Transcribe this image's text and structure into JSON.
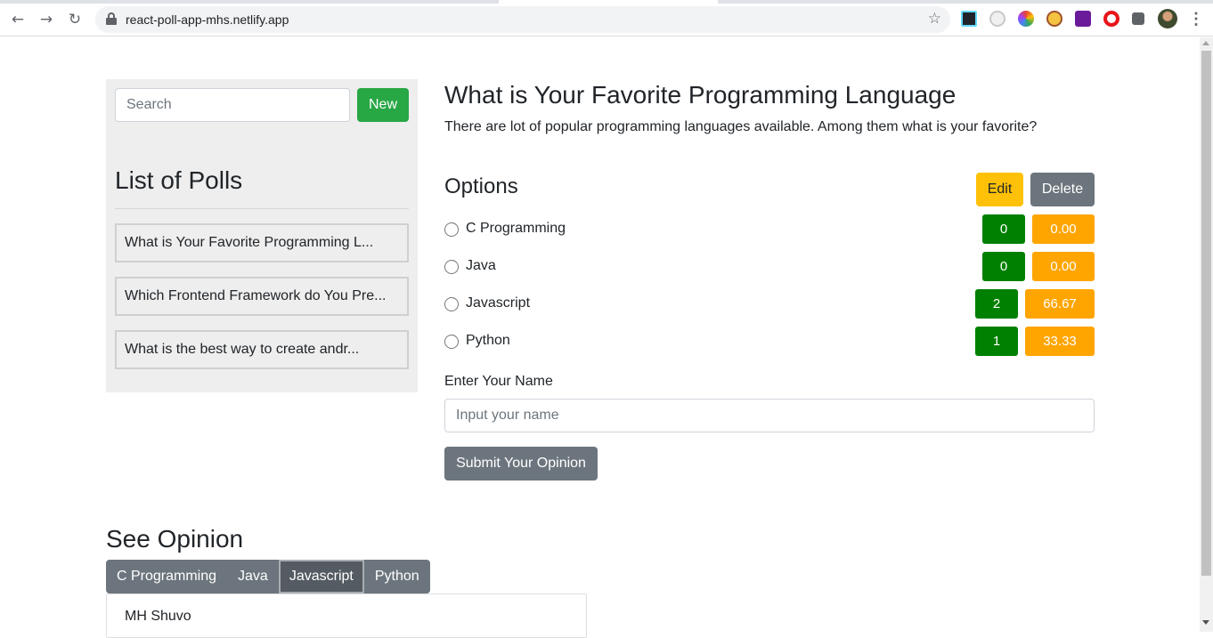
{
  "browser": {
    "url": "react-poll-app-mhs.netlify.app",
    "extension_icons": [
      "react-devtools-icon",
      "eyedropper-icon",
      "color-wheel-icon",
      "coin-icon",
      "extension-icon",
      "opera-icon",
      "puzzle-icon",
      "profile-avatar"
    ]
  },
  "sidebar": {
    "search_placeholder": "Search",
    "new_label": "New",
    "title": "List of Polls",
    "polls": [
      "What is Your Favorite Programming L...",
      "Which Frontend Framework do You Pre...",
      "What is the best way to create andr..."
    ]
  },
  "poll": {
    "title": "What is Your Favorite Programming Language",
    "description": "There are lot of popular programming languages available. Among them what is your favorite?",
    "options_title": "Options",
    "edit_label": "Edit",
    "delete_label": "Delete",
    "options": [
      {
        "label": "C Programming",
        "count": "0",
        "percent": "0.00"
      },
      {
        "label": "Java",
        "count": "0",
        "percent": "0.00"
      },
      {
        "label": "Javascript",
        "count": "2",
        "percent": "66.67"
      },
      {
        "label": "Python",
        "count": "1",
        "percent": "33.33"
      }
    ],
    "name_label": "Enter Your Name",
    "name_placeholder": "Input your name",
    "submit_label": "Submit Your Opinion"
  },
  "opinion": {
    "title": "See Opinion",
    "tabs": [
      "C Programming",
      "Java",
      "Javascript",
      "Python"
    ],
    "active_tab": "Javascript",
    "names": [
      "MH Shuvo"
    ]
  },
  "colors": {
    "new_button": "#28a745",
    "edit_button": "#ffc107",
    "secondary": "#6c757d",
    "count_badge": "#008000",
    "percent_badge": "#ffa500",
    "sidebar_bg": "#eeeeee"
  }
}
